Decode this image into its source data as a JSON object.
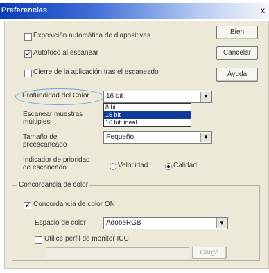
{
  "window": {
    "title": "Preferencias",
    "close_symbol": "x"
  },
  "buttons": {
    "ok": "Bien",
    "cancel": "Cancelar",
    "help": "Ayuda",
    "browse": "Carga"
  },
  "options": {
    "auto_exposure": {
      "label": "Exposición automática de diapositivas",
      "checked": false
    },
    "autofocus": {
      "label": "Autofoco al escanear",
      "checked": true
    },
    "close_after": {
      "label": "Cierre de la aplicación tras el escaneado",
      "checked": false
    }
  },
  "depth": {
    "label": "Profundidad del Color",
    "value": "16 bit",
    "options": [
      "8 bit",
      "16 bit",
      "16 bit lineal"
    ],
    "highlighted": "16 bit"
  },
  "multi_sample": {
    "label_line1": "Escanear muestras",
    "label_line2": "múltiples"
  },
  "prescan": {
    "label_line1": "Tamaño de",
    "label_line2": "preescaneado",
    "value": "Pequeño"
  },
  "priority": {
    "label_line1": "Indicador de prioridad",
    "label_line2": "de escaneado",
    "speed": "Velocidad",
    "quality": "Calidad",
    "selected": "Calidad"
  },
  "color_matching": {
    "group_title": "Concordancia de color",
    "enable_label": "Concordancia de color ON",
    "enabled": true,
    "space_label": "Espacio de color",
    "space_value": "AdobeRGB",
    "monitor_label": "Utilice perfil de monitor ICC",
    "monitor_checked": false
  },
  "icons": {
    "checked_mark": "✔",
    "dropdown_arrow": "▼"
  }
}
